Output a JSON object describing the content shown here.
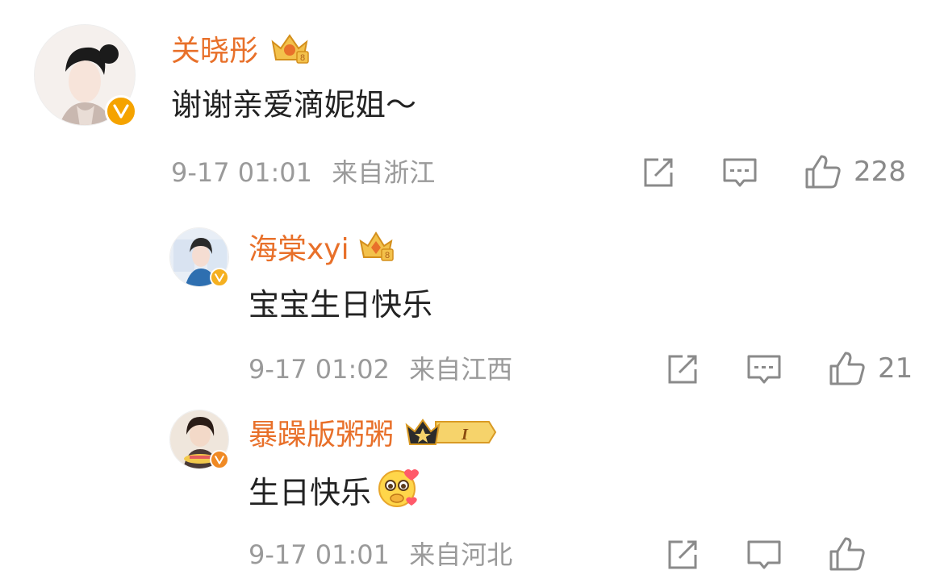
{
  "comments": [
    {
      "username": "关晓彤",
      "text": "谢谢亲爱滴妮姐～",
      "time": "9-17 01:01",
      "location": "来自浙江",
      "likes": "228"
    },
    {
      "username": "海棠xyi",
      "text": "宝宝生日快乐",
      "time": "9-17 01:02",
      "location": "来自江西",
      "likes": "21"
    },
    {
      "username": "暴躁版粥粥",
      "text": "生日快乐",
      "level_badge": "I",
      "time": "9-17 01:01",
      "location": "来自河北"
    }
  ],
  "colors": {
    "username": "#e8702a",
    "verified_badge": "#f5a300",
    "meta_text": "#9a9a9a",
    "icon": "#8a8a8a"
  },
  "icons": [
    "share-icon",
    "reply-icon",
    "like-icon",
    "verified-icon",
    "crown-icon",
    "emoji-icon"
  ]
}
